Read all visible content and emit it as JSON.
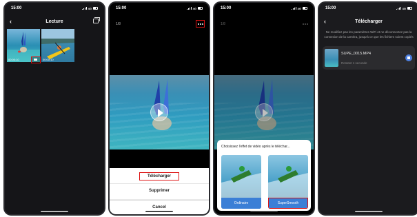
{
  "status": {
    "time": "15:00",
    "network": "4G"
  },
  "screen1": {
    "title": "Lecture",
    "thumbnails": [
      {
        "duration": "00:00:10"
      },
      {
        "duration": "00:00:10"
      }
    ]
  },
  "screen2": {
    "counter": "1/8",
    "actions": [
      "Télécharger",
      "Supprimer",
      "Cancel"
    ]
  },
  "screen3": {
    "counter": "1/8",
    "effect_prompt": "Choisissez l'effet de vidéo après le téléchar...",
    "effects": [
      "Ordinaire",
      "SuperSmooth"
    ]
  },
  "screen4": {
    "title": "Télécharger",
    "description": "Ne modifiez pas les paramètres WiFi et ne déconnectez pas la connexion de la caméra, jusqu'à ce que les fichiers soient copiés",
    "file": {
      "name": "SUPE_0015.MP4",
      "remaining": "Restant 1 seconde"
    }
  },
  "icons": {
    "back": "chevron-left-icon",
    "transfer": "transfer-icon",
    "more": "more-icon",
    "play": "play-icon",
    "stop": "stop-icon"
  },
  "colors": {
    "highlight": "#dd1111",
    "accent": "#3b7fd6",
    "background": "#151518"
  }
}
